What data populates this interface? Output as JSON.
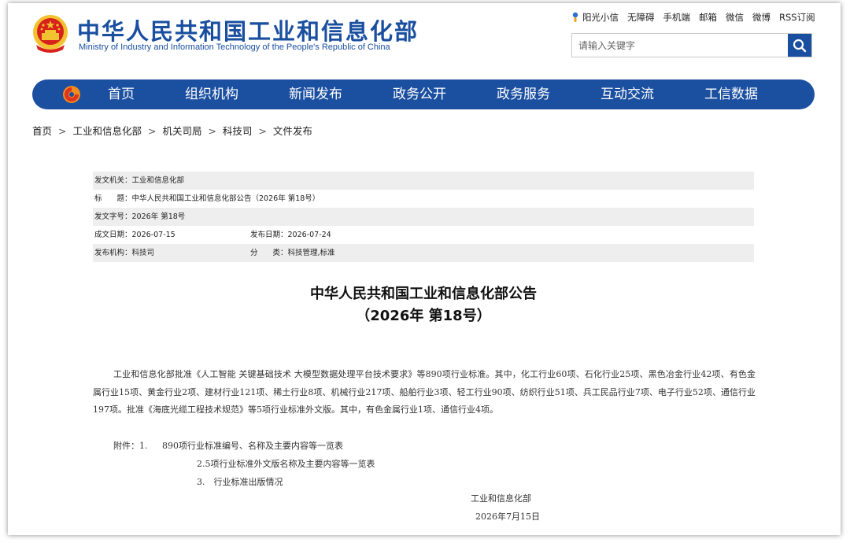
{
  "header": {
    "ministry_cn": "中华人民共和国工业和信息化部",
    "ministry_en": "Ministry of Industry and Information Technology of the People's Republic of China",
    "emblem_icon": "national-emblem-icon",
    "top_links": [
      "阳光小信",
      "无障碍",
      "手机端",
      "邮箱",
      "微信",
      "微博",
      "RSS订阅"
    ],
    "search": {
      "placeholder": "请输入关键字",
      "icon": "search-icon"
    }
  },
  "nav": {
    "logo_icon": "miit-logo-icon",
    "items": [
      "首页",
      "组织机构",
      "新闻发布",
      "政务公开",
      "政务服务",
      "互动交流",
      "工信数据"
    ]
  },
  "breadcrumb": [
    "首页",
    "工业和信息化部",
    "机关司局",
    "科技司",
    "文件发布"
  ],
  "breadcrumb_sep": ">",
  "meta": {
    "issuer_label": "发文机关：",
    "issuer": "工业和信息化部",
    "title_label": "标　　题：",
    "title": "中华人民共和国工业和信息化部公告（2026年 第18号）",
    "doc_no_label": "发文字号：",
    "doc_no": "2026年 第18号",
    "created_label": "成文日期：",
    "created": "2026-07-15",
    "published_label": "发布日期：",
    "published": "2026-07-24",
    "agency_label": "发布机构：",
    "agency": "科技司",
    "category_label": "分　　类：",
    "category": "科技管理,标准"
  },
  "document": {
    "title_line1": "中华人民共和国工业和信息化部公告",
    "title_line2": "（2026年 第18号）",
    "body": "工业和信息化部批准《人工智能 关键基础技术 大模型数据处理平台技术要求》等890项行业标准。其中，化工行业60项、石化行业25项、黑色冶金行业42项、有色金属行业15项、黄金行业2项、建材行业121项、稀土行业8项、机械行业217项、船舶行业3项、轻工行业90项、纺织行业51项、兵工民品行业7项、电子行业52项、通信行业197项。批准《海底光缆工程技术规范》等5项行业标准外文版。其中，有色金属行业1项、通信行业4项。",
    "attachments_label": "附件：1.",
    "attachments": [
      "890项行业标准编号、名称及主要内容等一览表",
      "2.5项行业标准外文版名称及主要内容等一览表",
      "3.　行业标准出版情况"
    ],
    "signature": "工业和信息化部",
    "date": "2026年7月15日"
  },
  "colors": {
    "brand_blue": "#1b4fa0",
    "meta_shade": "#eeeeee",
    "emblem_red": "#d7221c",
    "emblem_gold": "#f2c230"
  }
}
